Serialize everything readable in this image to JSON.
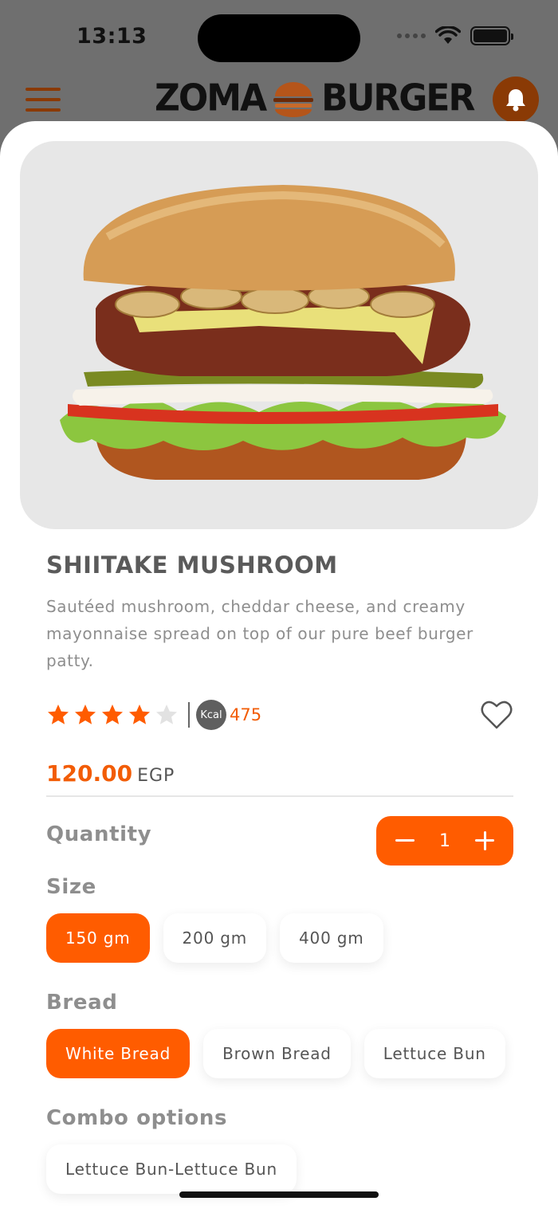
{
  "status_bar": {
    "time": "13:13"
  },
  "header": {
    "brand_left": "ZOMA",
    "brand_right": "BURGER"
  },
  "product": {
    "title": "SHIITAKE MUSHROOM",
    "description": "Sautéed mushroom, cheddar cheese, and creamy mayonnaise spread on top of our pure beef burger patty.",
    "rating": 4,
    "rating_max": 5,
    "kcal_badge": "Kcal",
    "kcal_value": "475",
    "price": "120.00",
    "currency": "EGP"
  },
  "quantity": {
    "label": "Quantity",
    "value": "1"
  },
  "size": {
    "label": "Size",
    "options": [
      "150 gm",
      "200 gm",
      "400 gm"
    ],
    "selected": 0
  },
  "bread": {
    "label": "Bread",
    "options": [
      "White Bread",
      "Brown Bread",
      "Lettuce Bun"
    ],
    "selected": 0
  },
  "combo": {
    "label": "Combo options",
    "options": [
      "Lettuce Bun-Lettuce Bun"
    ]
  },
  "colors": {
    "accent": "#FF5C00",
    "header_icon": "#8A3A05"
  },
  "icons": [
    "hamburger-menu-icon",
    "bell-icon",
    "star-icon",
    "heart-icon",
    "minus-icon",
    "plus-icon"
  ]
}
